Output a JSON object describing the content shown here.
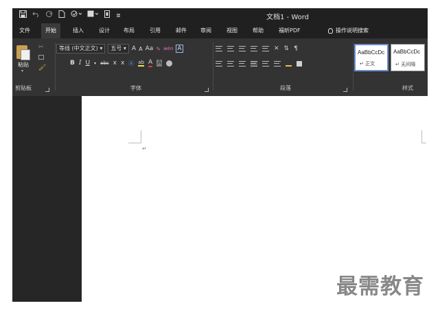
{
  "quick_access": {
    "save_icon": "save-icon",
    "undo_icon": "undo-icon",
    "redo_icon": "redo-icon",
    "new_icon": "new-document-icon",
    "format_painter_icon": "format-painter-icon",
    "table_icon": "table-icon",
    "doc_icon": "document-icon",
    "more_label": "≣"
  },
  "window": {
    "title": "文档1 - Word"
  },
  "tabs": [
    {
      "label": "文件"
    },
    {
      "label": "开始",
      "active": true
    },
    {
      "label": "插入"
    },
    {
      "label": "设计"
    },
    {
      "label": "布局"
    },
    {
      "label": "引用"
    },
    {
      "label": "邮件"
    },
    {
      "label": "审阅"
    },
    {
      "label": "视图"
    },
    {
      "label": "帮助"
    },
    {
      "label": "福昕PDF"
    }
  ],
  "tell_me": {
    "label": "操作说明搜索"
  },
  "clipboard": {
    "paste_label": "粘贴",
    "group_label": "剪贴板"
  },
  "font": {
    "font_name": "等线 (中文正文)",
    "font_size": "五号",
    "grow": "A",
    "shrink": "A",
    "change_case": "Aa",
    "phonetic": "wén",
    "border_char": "A",
    "bold": "B",
    "italic": "I",
    "underline": "U",
    "strike": "abc",
    "subscript": "x",
    "superscript": "x",
    "highlight": "ab",
    "font_color": "A",
    "shade": "A",
    "group_label": "字体"
  },
  "paragraph": {
    "group_label": "段落"
  },
  "styles": {
    "items": [
      {
        "preview": "AaBbCcDc",
        "name": "↵ 正文"
      },
      {
        "preview": "AaBbCcDc",
        "name": "↵ 无间隔"
      }
    ],
    "group_label": "样式"
  },
  "document": {
    "para_mark": "↵"
  },
  "watermark": {
    "text": "最需教育"
  },
  "colors": {
    "titlebar": "#202020",
    "ribbon": "#333333",
    "workspace": "#262626",
    "page": "#ffffff",
    "watermark": "#888888"
  }
}
